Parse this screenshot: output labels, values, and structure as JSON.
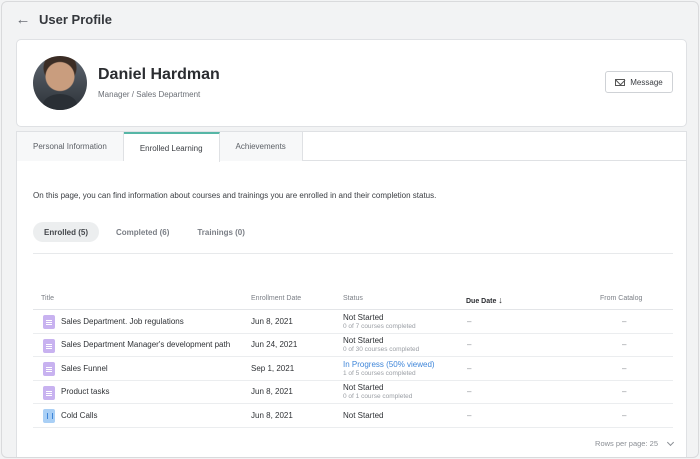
{
  "header": {
    "title": "User Profile",
    "back_icon": "arrow-left-icon"
  },
  "profile": {
    "name": "Daniel Hardman",
    "role": "Manager / Sales Department",
    "message_button": "Message"
  },
  "tabs": [
    {
      "label": "Personal Information",
      "active": false
    },
    {
      "label": "Enrolled Learning",
      "active": true
    },
    {
      "label": "Achievements",
      "active": false
    }
  ],
  "intro_text": "On this page, you can find information about courses and trainings you are enrolled in and their completion status.",
  "subtabs": [
    {
      "label": "Enrolled (5)",
      "active": true
    },
    {
      "label": "Completed (6)",
      "active": false
    },
    {
      "label": "Trainings (0)",
      "active": false
    }
  ],
  "table": {
    "columns": [
      "Title",
      "Enrollment Date",
      "Status",
      "Due Date",
      "From Catalog"
    ],
    "sort_icon": "arrow-down-icon",
    "rows": [
      {
        "title": "Sales Department. Job regulations",
        "date": "Jun 8, 2021",
        "status": "Not Started",
        "progress": "0 of 7 courses completed",
        "due": "–",
        "catalog": "–",
        "icon": "course-doc-icon"
      },
      {
        "title": "Sales Department Manager's development path",
        "date": "Jun 24, 2021",
        "status": "Not Started",
        "progress": "0 of 30 courses completed",
        "due": "–",
        "catalog": "–",
        "icon": "course-doc-icon"
      },
      {
        "title": "Sales Funnel",
        "date": "Sep 1, 2021",
        "status": "In Progress (50% viewed)",
        "progress": "1 of 5 courses completed",
        "due": "–",
        "catalog": "–",
        "icon": "course-doc-icon"
      },
      {
        "title": "Product tasks",
        "date": "Jun 8, 2021",
        "status": "Not Started",
        "progress": "0 of 1 course completed",
        "due": "–",
        "catalog": "–",
        "icon": "course-doc-icon"
      },
      {
        "title": "Cold Calls",
        "date": "Jun 8, 2021",
        "status": "Not Started",
        "progress": "",
        "due": "–",
        "catalog": "–",
        "icon": "upload-doc-icon"
      }
    ]
  },
  "footer": {
    "rows_per_page": "Rows per page: 25"
  },
  "colors": {
    "accent": "#56b6a6",
    "link": "#3f86d9",
    "doc_icon": "#c8b2f0",
    "upload_icon": "#a9cff5"
  }
}
